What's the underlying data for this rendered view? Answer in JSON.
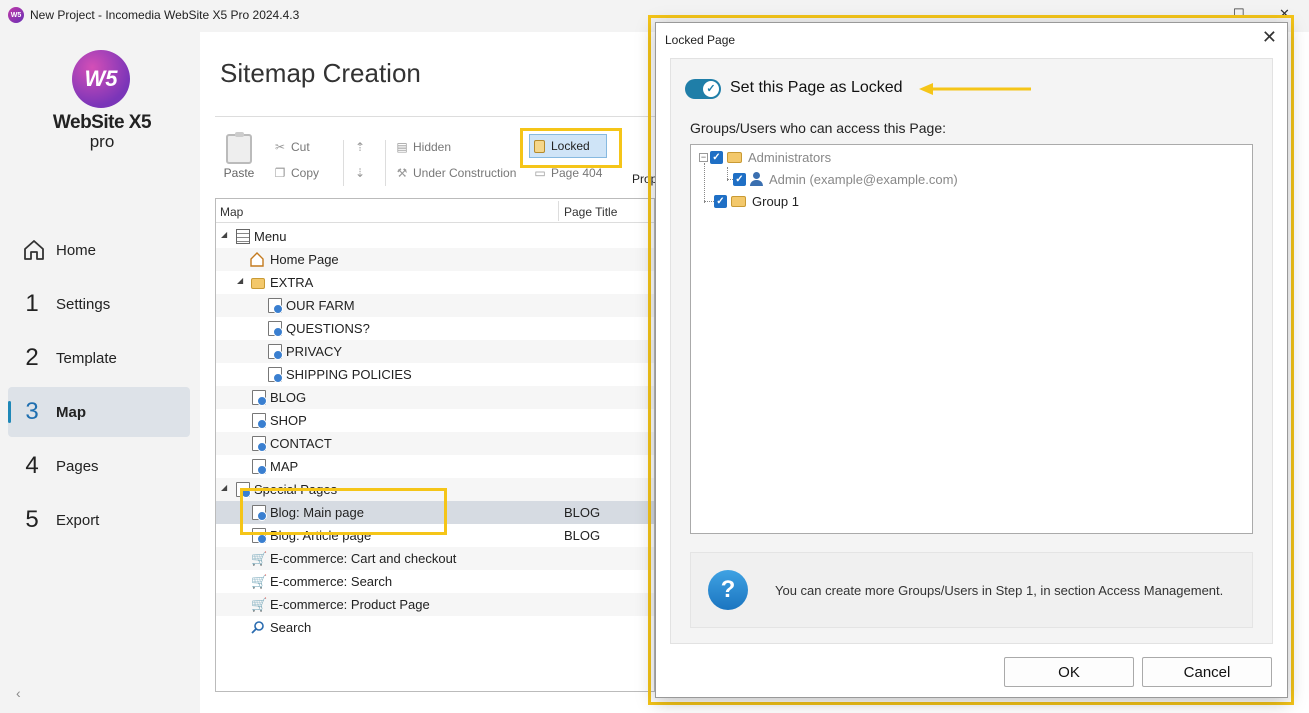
{
  "window": {
    "app_icon_text": "W5",
    "title": "New Project - Incomedia WebSite X5 Pro 2024.4.3"
  },
  "sidebar": {
    "logo_mark": "W5",
    "logo_name": "WebSite X5",
    "logo_edition": "pro",
    "items": [
      {
        "num": "",
        "label": "Home"
      },
      {
        "num": "1",
        "label": "Settings"
      },
      {
        "num": "2",
        "label": "Template"
      },
      {
        "num": "3",
        "label": "Map",
        "active": true
      },
      {
        "num": "4",
        "label": "Pages"
      },
      {
        "num": "5",
        "label": "Export"
      }
    ]
  },
  "main": {
    "heading": "Sitemap Creation",
    "toolbar": {
      "paste": "Paste",
      "cut": "Cut",
      "copy": "Copy",
      "hidden": "Hidden",
      "under_construction": "Under Construction",
      "locked": "Locked",
      "page404": "Page 404",
      "properties_partial": "Prop"
    },
    "tree": {
      "col_map": "Map",
      "col_page_title": "Page Title",
      "rows": [
        {
          "label": "Menu",
          "title": ""
        },
        {
          "label": "Home Page",
          "title": ""
        },
        {
          "label": "EXTRA",
          "title": ""
        },
        {
          "label": "OUR FARM",
          "title": ""
        },
        {
          "label": "QUESTIONS?",
          "title": ""
        },
        {
          "label": "PRIVACY",
          "title": ""
        },
        {
          "label": "SHIPPING POLICIES",
          "title": ""
        },
        {
          "label": "BLOG",
          "title": ""
        },
        {
          "label": "SHOP",
          "title": ""
        },
        {
          "label": "CONTACT",
          "title": ""
        },
        {
          "label": "MAP",
          "title": ""
        },
        {
          "label": "Special Pages",
          "title": ""
        },
        {
          "label": "Blog: Main page",
          "title": "BLOG"
        },
        {
          "label": "Blog: Article page",
          "title": "BLOG"
        },
        {
          "label": "E-commerce: Cart and checkout",
          "title": ""
        },
        {
          "label": "E-commerce: Search",
          "title": ""
        },
        {
          "label": "E-commerce: Product Page",
          "title": ""
        },
        {
          "label": "Search",
          "title": ""
        }
      ]
    }
  },
  "dialog": {
    "title": "Locked Page",
    "toggle_label": "Set this Page as Locked",
    "toggle_on": true,
    "access_label": "Groups/Users who can access this Page:",
    "access_tree": {
      "group_admins": "Administrators",
      "user_admin": "Admin (example@example.com)",
      "group_1": "Group 1"
    },
    "info_icon_text": "?",
    "info_text": "You can create more Groups/Users in Step 1, in section Access Management.",
    "ok": "OK",
    "cancel": "Cancel"
  },
  "colors": {
    "highlight": "#f5c518",
    "accent": "#1f7ea8",
    "selected_row": "#d6dbe2",
    "checkbox": "#1f6fc5"
  }
}
